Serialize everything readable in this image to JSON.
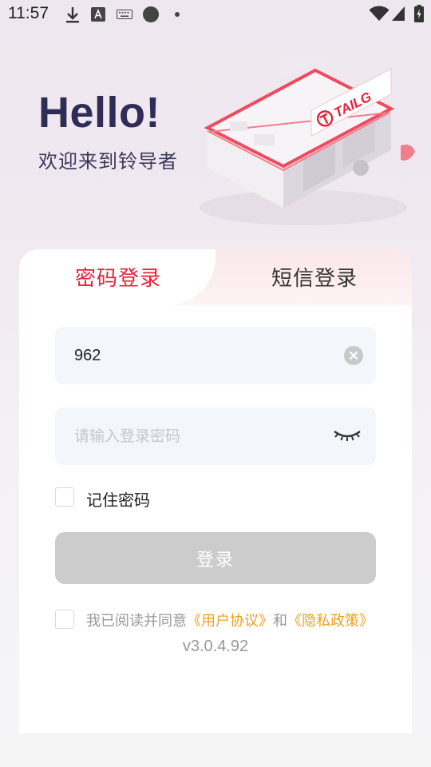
{
  "status_bar": {
    "time": "11:57",
    "left_icons": [
      "download-icon",
      "a-badge-icon",
      "keyboard-icon",
      "circle-icon",
      "dot-icon"
    ],
    "right_icons": [
      "wifi-icon",
      "signal-icon",
      "battery-charging-icon"
    ]
  },
  "header": {
    "title": "Hello!",
    "subtitle": "欢迎来到铃导者",
    "illustration_brand": "TAILG",
    "illustration_icon": "store-building-illustration"
  },
  "tabs": [
    {
      "label": "密码登录",
      "active": true
    },
    {
      "label": "短信登录",
      "active": false
    }
  ],
  "form": {
    "username_value": "962",
    "username_clear_icon": "clear-icon",
    "password_placeholder": "请输入登录密码",
    "password_toggle_icon": "eye-closed-icon",
    "remember_label": "记住密码",
    "remember_checked": false,
    "login_label": "登录"
  },
  "agreement": {
    "checked": false,
    "prefix": "我已阅读并同意",
    "user_agreement": "《用户协议》",
    "and": "和",
    "privacy_policy": "《隐私政策》"
  },
  "version": "v3.0.4.92",
  "colors": {
    "accent_red": "#e8213a",
    "link_orange": "#f0a020",
    "title_navy": "#2e2d55",
    "button_disabled": "#cccccc"
  }
}
